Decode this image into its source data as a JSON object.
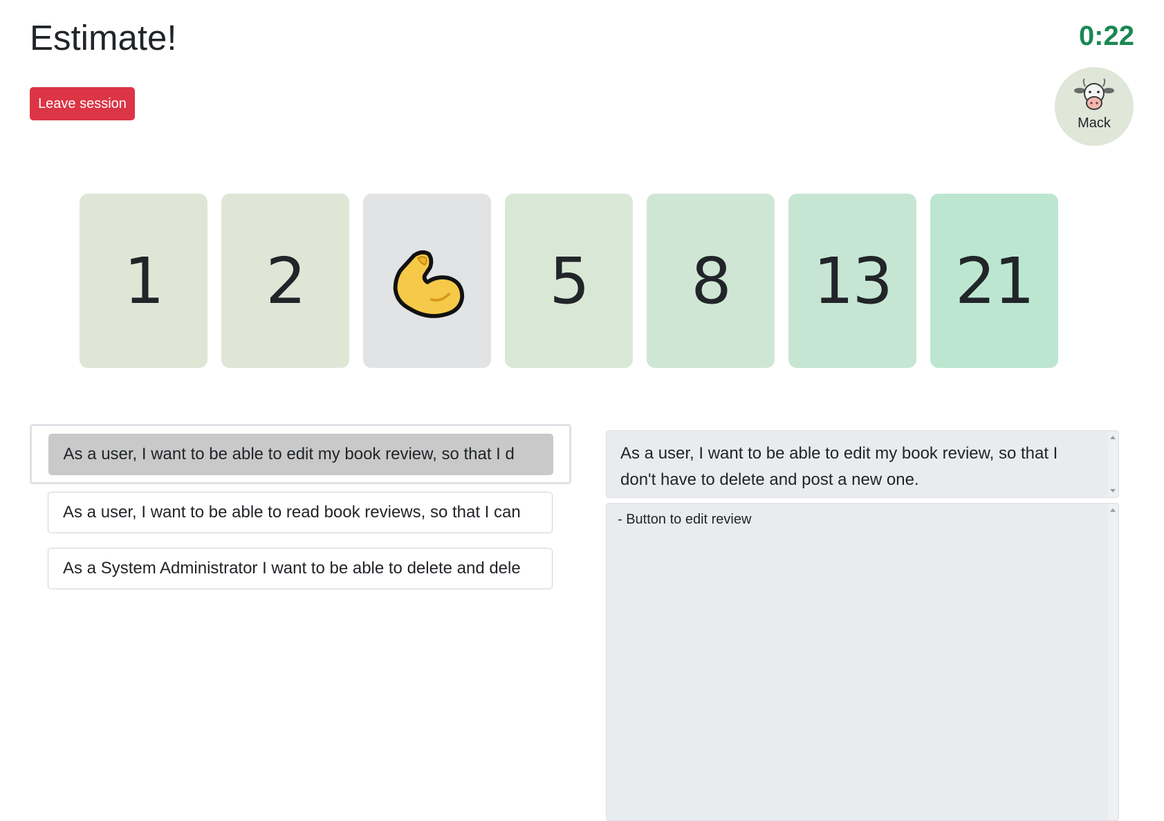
{
  "header": {
    "title": "Estimate!",
    "timer": "0:22",
    "timer_color": "#198754"
  },
  "actions": {
    "leave_label": "Leave session",
    "leave_color": "#dc3545"
  },
  "participant": {
    "name": "Mack",
    "avatar_icon": "cow-icon"
  },
  "cards": [
    {
      "value": "1",
      "bg": "#dfe6d6"
    },
    {
      "value": "2",
      "bg": "#dfe6d6"
    },
    {
      "value": "",
      "icon": "flexed-biceps-icon",
      "bg": "#e2e3e5",
      "selected": true
    },
    {
      "value": "5",
      "bg": "#d8e8d5"
    },
    {
      "value": "8",
      "bg": "#d0e6d5"
    },
    {
      "value": "13",
      "bg": "#c6e6d3"
    },
    {
      "value": "21",
      "bg": "#bde6d0"
    }
  ],
  "stories": [
    {
      "text": "As a user, I want to be able to edit my book review, so that I d",
      "selected": true
    },
    {
      "text": "As a user, I want to be able to read book reviews, so that I can",
      "selected": false
    },
    {
      "text": "As a System Administrator I want to be able to delete and dele",
      "selected": false
    }
  ],
  "detail": {
    "title": "As a user, I want to be able to edit my book review, so that I don't have to delete and post a new one.",
    "notes": "- Button to edit review"
  }
}
